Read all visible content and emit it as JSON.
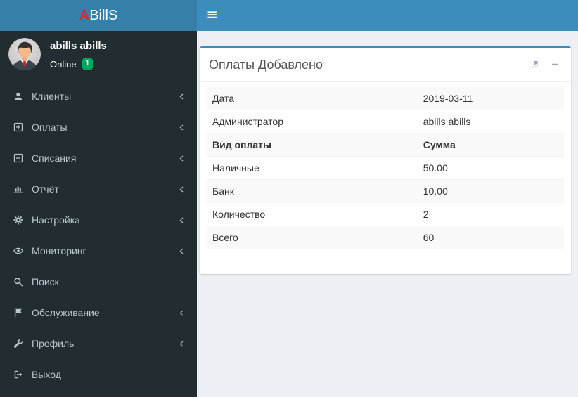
{
  "brand": {
    "prefix": "A",
    "rest": "BillS"
  },
  "topbar": {
    "menu_icon": "hamburger-icon"
  },
  "sidebar": {
    "user": {
      "name": "abills abills",
      "status": "Online",
      "badge": "1"
    },
    "items": [
      {
        "key": "clients",
        "label": "Клиенты",
        "icon": "user-icon",
        "has_submenu": true
      },
      {
        "key": "payments",
        "label": "Оплаты",
        "icon": "plus-square-icon",
        "has_submenu": true
      },
      {
        "key": "fees",
        "label": "Списания",
        "icon": "minus-square-icon",
        "has_submenu": true
      },
      {
        "key": "report",
        "label": "Отчёт",
        "icon": "bar-chart-icon",
        "has_submenu": true
      },
      {
        "key": "settings",
        "label": "Настройка",
        "icon": "gear-icon",
        "has_submenu": true
      },
      {
        "key": "monitoring",
        "label": "Мониторинг",
        "icon": "eye-icon",
        "has_submenu": true
      },
      {
        "key": "search",
        "label": "Поиск",
        "icon": "search-icon",
        "has_submenu": false
      },
      {
        "key": "maintenance",
        "label": "Обслуживание",
        "icon": "flag-icon",
        "has_submenu": true
      },
      {
        "key": "profile",
        "label": "Профиль",
        "icon": "wrench-icon",
        "has_submenu": true
      },
      {
        "key": "logout",
        "label": "Выход",
        "icon": "sign-out-icon",
        "has_submenu": false
      }
    ]
  },
  "panel": {
    "title": "Оплаты Добавлено",
    "tools": [
      "export-icon",
      "collapse-icon"
    ],
    "rows": [
      {
        "label": "Дата",
        "value": "2019-03-11",
        "bold": false
      },
      {
        "label": "Администратор",
        "value": "abills abills",
        "bold": false
      },
      {
        "label": "Вид оплаты",
        "value": "Сумма",
        "bold": true
      },
      {
        "label": "Наличные",
        "value": "50.00",
        "bold": false
      },
      {
        "label": "Банк",
        "value": "10.00",
        "bold": false
      },
      {
        "label": "Количество",
        "value": "2",
        "bold": false
      },
      {
        "label": "Всего",
        "value": "60",
        "bold": false
      }
    ]
  },
  "colors": {
    "navbar": "#3c8dbc",
    "logo_bg": "#367fa9",
    "sidebar_bg": "#222d32",
    "sidebar_text": "#b8c7ce",
    "content_bg": "#ecf0f5",
    "panel_accent": "#3c8dbc",
    "panel_tools": "#9aa5b8",
    "title_text": "#555555",
    "badge_online": "#00a65a",
    "brand_accent": "#e3262d",
    "row_stripe": "#f9f9f9",
    "text_dark": "#333333"
  }
}
